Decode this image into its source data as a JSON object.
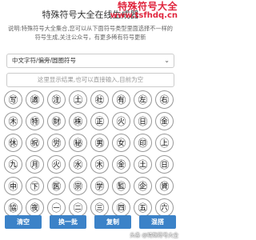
{
  "header": {
    "title": "特殊符号大全在线生成器",
    "watermark_line1": "特殊符号大全",
    "watermark_line2": "www.tsfhdq.cn"
  },
  "description": "说明:特殊符号大全集合,您可以从下面符号类型里面选择不一样的符号生成,关注公众号，有更多稀有符号更新",
  "select": {
    "value": "中文字符/偏旁/圆圈符号"
  },
  "output": {
    "placeholder": "这里显示结果,也可以直接输入,目前为空"
  },
  "symbols": [
    "㊢",
    "㊜",
    "㊟",
    "㊏",
    "㊓",
    "㊒",
    "㊧",
    "㊨",
    "㊍",
    "㊕",
    "㊖",
    "㊑",
    "㊣",
    "㊋",
    "㊐",
    "㊎",
    "㊡",
    "㊗",
    "㊘",
    "㊙",
    "㊚",
    "㊛",
    "㊞",
    "㊤",
    "㊈",
    "㊊",
    "㊋",
    "㊌",
    "㊍",
    "㊎",
    "㊏",
    "㊐",
    "㊥",
    "㊦",
    "㊩",
    "㊪",
    "㊫",
    "㊬",
    "㊭",
    "㊮",
    "㊯",
    "㊰",
    "㊀",
    "㊁",
    "㊂",
    "㊃",
    "㊄",
    "㊅"
  ],
  "buttons": {
    "clear": "清空",
    "change": "换一批",
    "copy": "复制",
    "mix": "混搭"
  },
  "footer": {
    "watermark": "头条 @特殊符号大全"
  }
}
